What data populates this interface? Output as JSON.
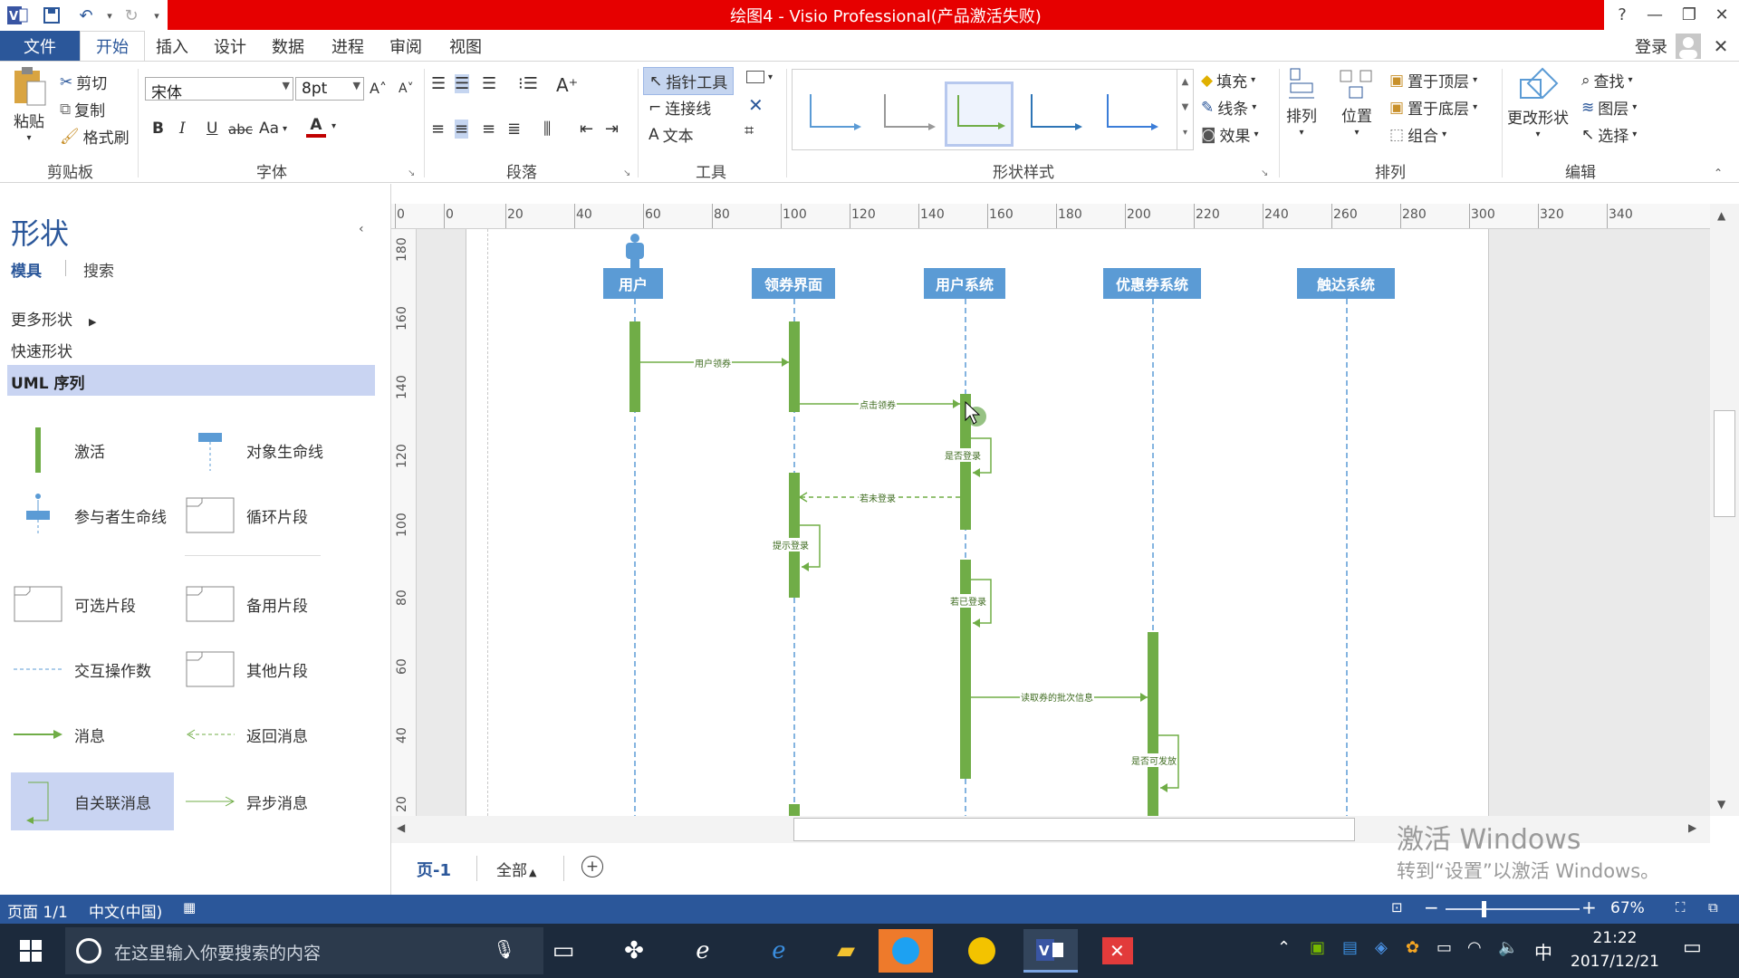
{
  "window": {
    "title": "绘图4 -  Visio Professional(产品激活失败)",
    "help": "?",
    "minimize": "—",
    "restore": "❐",
    "close": "✕"
  },
  "menu": {
    "tabs": [
      "文件",
      "开始",
      "插入",
      "设计",
      "数据",
      "进程",
      "审阅",
      "视图"
    ],
    "login": "登录"
  },
  "ribbon": {
    "clipboard": {
      "paste": "粘贴",
      "cut": "剪切",
      "copy": "复制",
      "format_painter": "格式刷",
      "label": "剪贴板"
    },
    "font": {
      "name": "宋体",
      "size": "8pt",
      "bold": "B",
      "italic": "I",
      "underline": "U",
      "strike": "abc",
      "case": "Aa",
      "color": "A",
      "label": "字体"
    },
    "paragraph": {
      "label": "段落"
    },
    "tools": {
      "pointer": "指针工具",
      "connector": "连接线",
      "text": "文本",
      "label": "工具"
    },
    "shape_styles": {
      "fill": "填充",
      "line": "线条",
      "effects": "效果",
      "label": "形状样式"
    },
    "arrange": {
      "arrange": "排列",
      "position": "位置",
      "bring_front": "置于顶层",
      "send_back": "置于底层",
      "group": "组合",
      "label": "排列"
    },
    "edit": {
      "change_shape": "更改形状",
      "find": "查找",
      "layers": "图层",
      "select": "选择",
      "label": "编辑"
    }
  },
  "shapes_panel": {
    "title": "形状",
    "tab_stencils": "模具",
    "tab_search": "搜索",
    "more_shapes": "更多形状",
    "quick_shapes": "快速形状",
    "uml_sequence": "UML 序列",
    "items": [
      {
        "label": "激活"
      },
      {
        "label": "对象生命线"
      },
      {
        "label": "参与者生命线"
      },
      {
        "label": "循环片段"
      },
      {
        "label": "可选片段"
      },
      {
        "label": "备用片段"
      },
      {
        "label": "交互操作数"
      },
      {
        "label": "其他片段"
      },
      {
        "label": "消息"
      },
      {
        "label": "返回消息"
      },
      {
        "label": "自关联消息"
      },
      {
        "label": "异步消息"
      }
    ]
  },
  "ruler": {
    "top": [
      "0",
      "0",
      "20",
      "40",
      "60",
      "80",
      "100",
      "120",
      "140",
      "160",
      "180",
      "200",
      "220",
      "240",
      "260",
      "280",
      "300",
      "320",
      "340"
    ],
    "left": [
      "180",
      "160",
      "140",
      "120",
      "100",
      "80",
      "60",
      "40",
      "20"
    ]
  },
  "diagram": {
    "lifelines": [
      "用户",
      "领券界面",
      "用户系统",
      "优惠券系统",
      "触达系统"
    ],
    "messages": [
      "用户领券",
      "点击领券",
      "是否登录",
      "若未登录",
      "提示登录",
      "若已登录",
      "读取券的批次信息",
      "是否可发放"
    ]
  },
  "page_tabs": {
    "page1": "页-1",
    "all": "全部",
    "add": "+"
  },
  "watermark": {
    "line1": "激活 Windows",
    "line2": "转到“设置”以激活 Windows。"
  },
  "status": {
    "page": "页面 1/1",
    "language": "中文(中国)",
    "zoom": "67%"
  },
  "taskbar": {
    "search_placeholder": "在这里输入你要搜索的内容",
    "time": "21:22",
    "date": "2017/12/21",
    "ime": "中"
  }
}
